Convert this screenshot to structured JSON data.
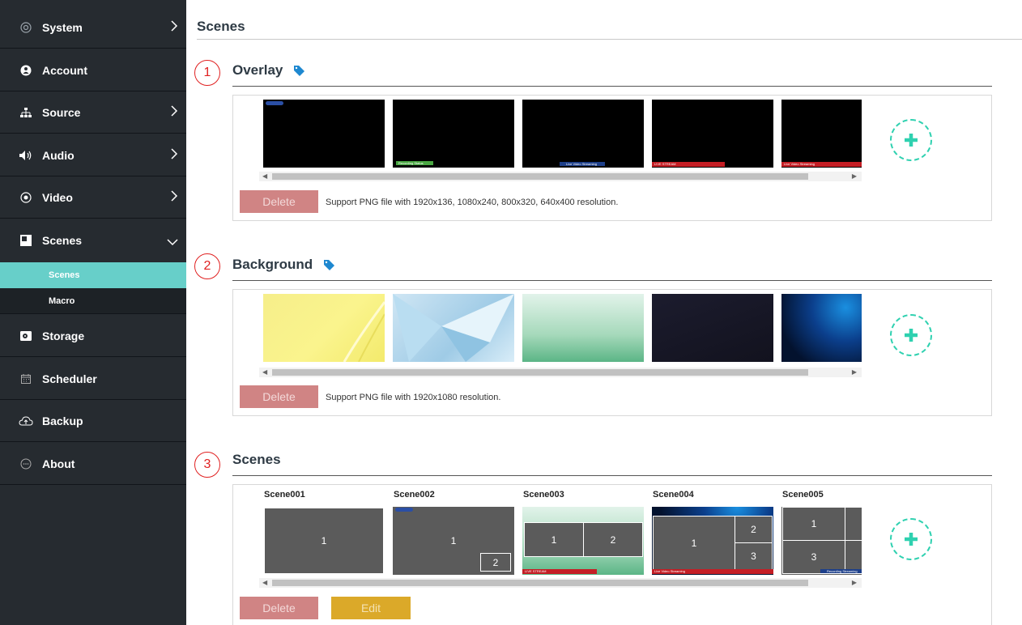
{
  "sidebar": {
    "items": [
      {
        "label": "System",
        "icon": "gear-icon"
      },
      {
        "label": "Account",
        "icon": "user-icon"
      },
      {
        "label": "Source",
        "icon": "network-icon"
      },
      {
        "label": "Audio",
        "icon": "speaker-icon"
      },
      {
        "label": "Video",
        "icon": "radio-dot-icon"
      },
      {
        "label": "Scenes",
        "icon": "scenes-icon"
      },
      {
        "label": "Storage",
        "icon": "storage-icon"
      },
      {
        "label": "Scheduler",
        "icon": "calendar-icon"
      },
      {
        "label": "Backup",
        "icon": "cloud-upload-icon"
      },
      {
        "label": "About",
        "icon": "chat-dots-icon"
      }
    ],
    "sub_items": [
      {
        "label": "Scenes",
        "active": true
      },
      {
        "label": "Macro",
        "active": false
      }
    ]
  },
  "page": {
    "title": "Scenes"
  },
  "overlay": {
    "number": "1",
    "title": "Overlay",
    "note": "Support PNG file with 1920x136, 1080x240, 800x320, 640x400 resolution.",
    "delete_label": "Delete",
    "thumb_texts": [
      "Recording Status",
      "Live Video Streaming",
      "LIVE STREAM",
      "Live Video Streaming"
    ]
  },
  "background": {
    "number": "2",
    "title": "Background",
    "note": "Support PNG file with 1920x1080 resolution.",
    "delete_label": "Delete"
  },
  "scenes": {
    "number": "3",
    "title": "Scenes",
    "delete_label": "Delete",
    "edit_label": "Edit",
    "items": [
      {
        "name": "Scene001",
        "windows": [
          "1"
        ]
      },
      {
        "name": "Scene002",
        "windows": [
          "1",
          "2"
        ]
      },
      {
        "name": "Scene003",
        "windows": [
          "1",
          "2"
        ],
        "bar_text": "LIVE STREAM"
      },
      {
        "name": "Scene004",
        "windows": [
          "1",
          "2",
          "3"
        ],
        "bar_text": "Live Video Streaming"
      },
      {
        "name": "Scene005",
        "windows": [
          "1",
          "3"
        ],
        "bar_text": "Recording Streaming"
      }
    ]
  },
  "colors": {
    "sidebar_bg": "#262b30",
    "active_teal": "#67cfc9",
    "delete_btn": "#d08484",
    "edit_btn": "#dba929",
    "add_accent": "#2fd1b0",
    "marker_red": "#e02020",
    "tag_blue": "#1e88d0"
  }
}
